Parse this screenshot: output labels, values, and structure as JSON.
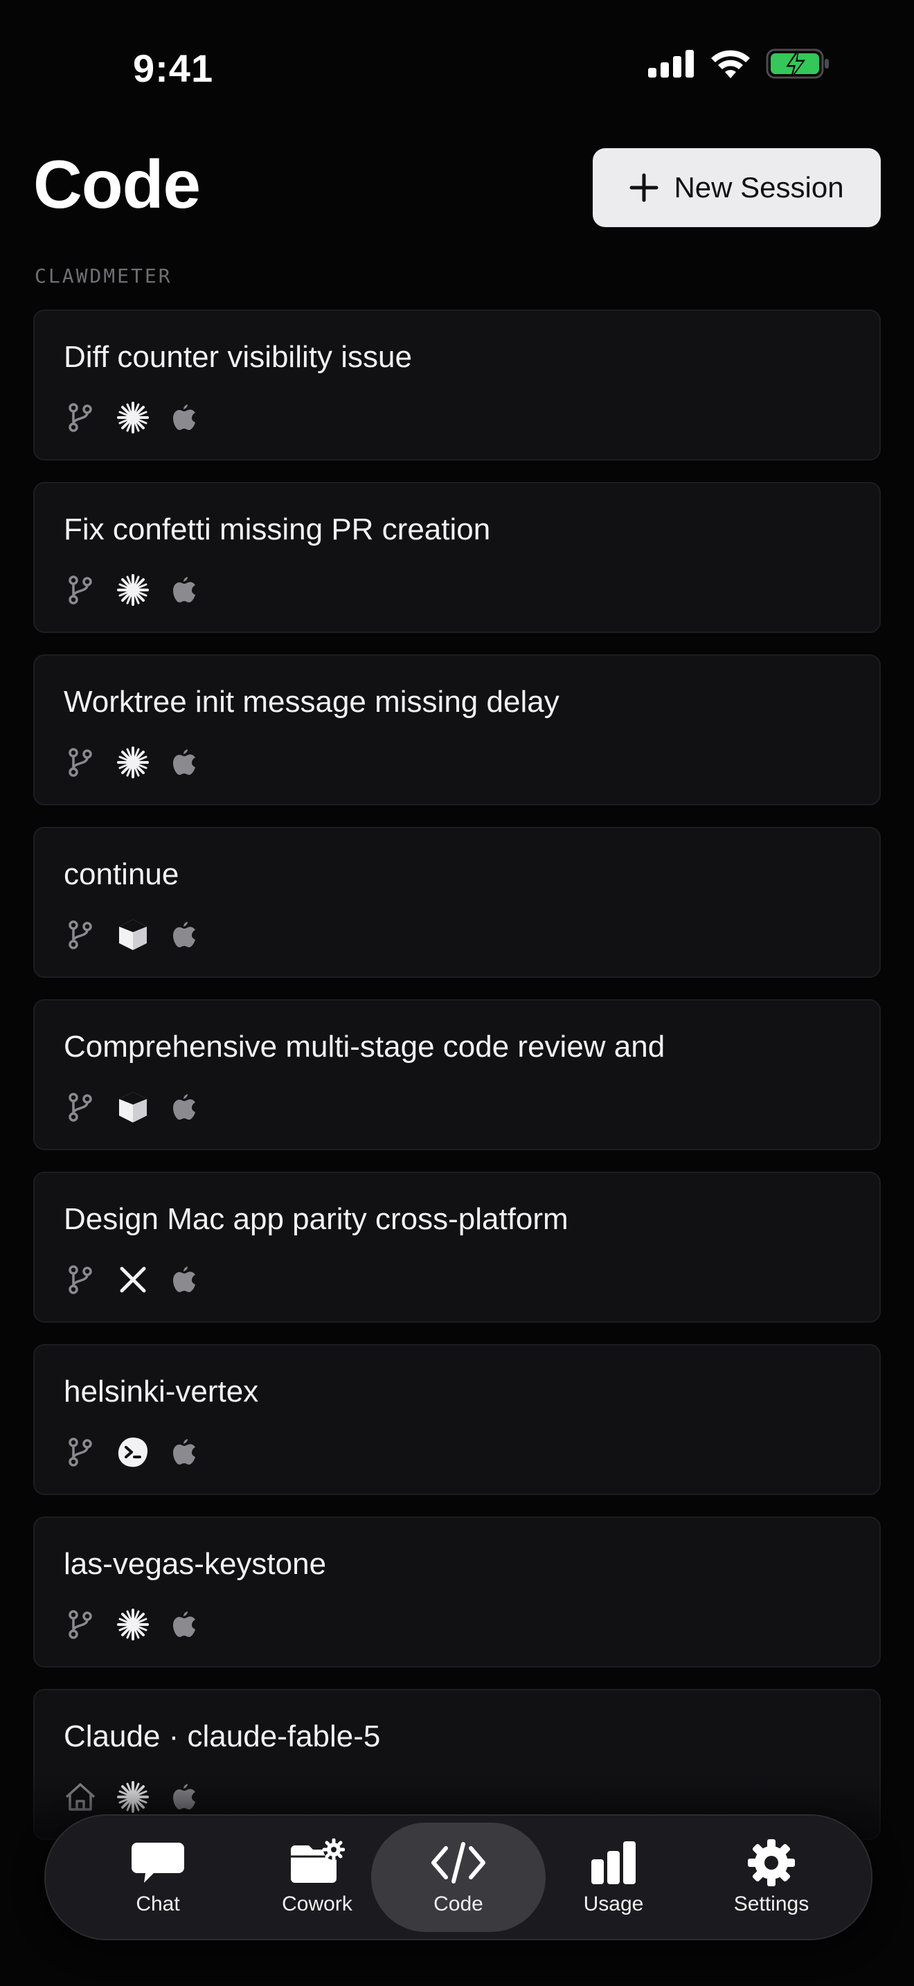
{
  "status": {
    "time": "9:41"
  },
  "header": {
    "title": "Code",
    "new_session_label": "New Session"
  },
  "section": {
    "label": "CLAWDMETER"
  },
  "sessions": [
    {
      "title": "Diff counter visibility issue",
      "source": "branch-icon",
      "model": "sparkle-icon",
      "platform": "apple-icon"
    },
    {
      "title": "Fix confetti missing PR creation",
      "source": "branch-icon",
      "model": "sparkle-icon",
      "platform": "apple-icon"
    },
    {
      "title": "Worktree init message missing delay",
      "source": "branch-icon",
      "model": "sparkle-icon",
      "platform": "apple-icon"
    },
    {
      "title": "continue",
      "source": "branch-icon",
      "model": "cube-icon",
      "platform": "apple-icon"
    },
    {
      "title": "Comprehensive multi-stage code review and",
      "source": "branch-icon",
      "model": "cube-icon",
      "platform": "apple-icon"
    },
    {
      "title": "Design Mac app parity cross-platform",
      "source": "branch-icon",
      "model": "x-logo-icon",
      "platform": "apple-icon"
    },
    {
      "title": "helsinki-vertex",
      "source": "branch-icon",
      "model": "terminal-blob-icon",
      "platform": "apple-icon"
    },
    {
      "title": "las-vegas-keystone",
      "source": "branch-icon",
      "model": "sparkle-icon",
      "platform": "apple-icon"
    },
    {
      "title": "Claude · claude-fable-5",
      "source": "house-icon",
      "model": "sparkle-icon",
      "platform": "apple-icon"
    }
  ],
  "tabs": [
    {
      "label": "Chat",
      "icon": "chat-bubble-icon"
    },
    {
      "label": "Cowork",
      "icon": "folder-gear-icon"
    },
    {
      "label": "Code",
      "icon": "code-brackets-icon",
      "active": true
    },
    {
      "label": "Usage",
      "icon": "bar-chart-icon"
    },
    {
      "label": "Settings",
      "icon": "gear-icon"
    }
  ],
  "colors": {
    "background": "#050506",
    "card": "#111114",
    "button": "#ececee",
    "battery": "#34c759",
    "tab_active": "#3a3a3f"
  }
}
